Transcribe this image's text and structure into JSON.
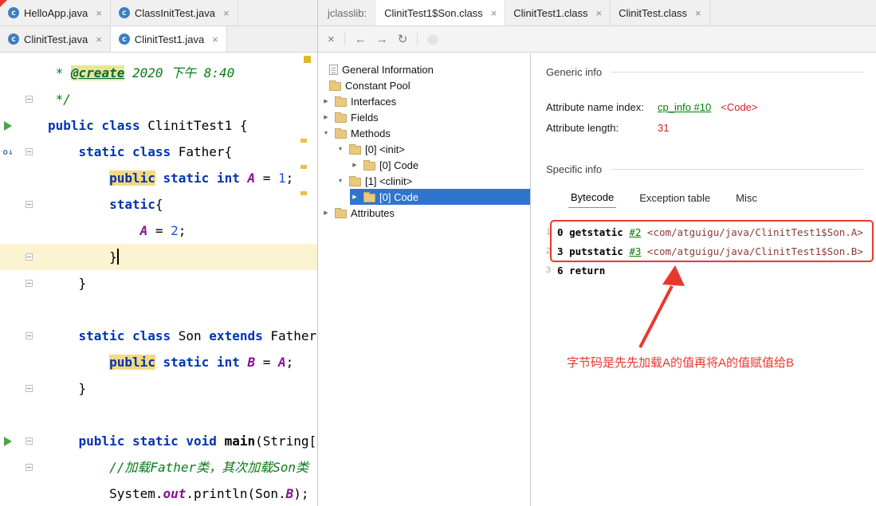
{
  "colors": {
    "annotation_red": "#E8382E",
    "tree_selection_blue": "#2E75CF",
    "link_green": "#008000",
    "keyword_blue": "#0033B3"
  },
  "icons": {
    "close": "×",
    "back": "←",
    "forward": "→",
    "refresh": "↻",
    "web": "◎",
    "java_class": "c",
    "expanded": "▼",
    "collapsed": "▶",
    "subclass": "o↓"
  },
  "editor_tabs": {
    "row1": [
      {
        "label": "HelloApp.java",
        "selected": false
      },
      {
        "label": "ClassInitTest.java",
        "selected": false
      }
    ],
    "row2": [
      {
        "label": "ClinitTest.java",
        "selected": false
      },
      {
        "label": "ClinitTest1.java",
        "selected": true
      }
    ]
  },
  "jclasslib": {
    "panel_label": "jclasslib:",
    "tabs": [
      {
        "label": "ClinitTest1$Son.class",
        "selected": true
      },
      {
        "label": "ClinitTest1.class",
        "selected": false
      },
      {
        "label": "ClinitTest.class",
        "selected": false
      }
    ],
    "toolbar": [
      {
        "name": "close",
        "glyph": "×"
      },
      {
        "sep": true
      },
      {
        "name": "back",
        "glyph": "←"
      },
      {
        "name": "forward",
        "glyph": "→"
      },
      {
        "name": "refresh",
        "glyph": "↻"
      },
      {
        "sep": true
      },
      {
        "name": "web",
        "glyph": "◎",
        "disabled": true
      }
    ]
  },
  "editor": {
    "lines": [
      {
        "tokens": [
          {
            "t": " * ",
            "c": "cmt"
          },
          {
            "t": "@create",
            "c": "tag"
          },
          {
            "t": " 2020 下午 8:40",
            "c": "cmt"
          }
        ]
      },
      {
        "fold": true,
        "tokens": [
          {
            "t": " */",
            "c": "cmt"
          }
        ]
      },
      {
        "run": true,
        "tokens": [
          {
            "t": "public class ",
            "c": "kw"
          },
          {
            "t": "ClinitTest1 {",
            "c": "pl"
          }
        ]
      },
      {
        "override": true,
        "fold": true,
        "tokens": [
          {
            "t": "    ",
            "c": "pl"
          },
          {
            "t": "static class ",
            "c": "kw"
          },
          {
            "t": "Father{",
            "c": "pl"
          }
        ]
      },
      {
        "tokens": [
          {
            "t": "        ",
            "c": "pl"
          },
          {
            "t": "public",
            "c": "kwhl"
          },
          {
            "t": " ",
            "c": "pl"
          },
          {
            "t": "static int ",
            "c": "kw"
          },
          {
            "t": "A",
            "c": "fld"
          },
          {
            "t": " = ",
            "c": "pl"
          },
          {
            "t": "1",
            "c": "num"
          },
          {
            "t": ";",
            "c": "pl"
          }
        ]
      },
      {
        "fold": true,
        "tokens": [
          {
            "t": "        ",
            "c": "pl"
          },
          {
            "t": "static",
            "c": "kw"
          },
          {
            "t": "{",
            "c": "pl"
          }
        ]
      },
      {
        "tokens": [
          {
            "t": "            ",
            "c": "pl"
          },
          {
            "t": "A",
            "c": "fld"
          },
          {
            "t": " = ",
            "c": "pl"
          },
          {
            "t": "2",
            "c": "num"
          },
          {
            "t": ";",
            "c": "pl"
          }
        ]
      },
      {
        "current": true,
        "caret": true,
        "fold": true,
        "tokens": [
          {
            "t": "        }",
            "c": "pl"
          }
        ]
      },
      {
        "fold": true,
        "tokens": [
          {
            "t": "    }",
            "c": "pl"
          }
        ]
      },
      {
        "tokens": []
      },
      {
        "fold": true,
        "tokens": [
          {
            "t": "    ",
            "c": "pl"
          },
          {
            "t": "static class ",
            "c": "kw"
          },
          {
            "t": "Son ",
            "c": "pl"
          },
          {
            "t": "extends ",
            "c": "kw"
          },
          {
            "t": "Father{",
            "c": "pl"
          }
        ]
      },
      {
        "tokens": [
          {
            "t": "        ",
            "c": "pl"
          },
          {
            "t": "public",
            "c": "kwhl"
          },
          {
            "t": " ",
            "c": "pl"
          },
          {
            "t": "static int ",
            "c": "kw"
          },
          {
            "t": "B",
            "c": "fld"
          },
          {
            "t": " = ",
            "c": "pl"
          },
          {
            "t": "A",
            "c": "fld"
          },
          {
            "t": ";",
            "c": "pl"
          }
        ]
      },
      {
        "fold": true,
        "tokens": [
          {
            "t": "    }",
            "c": "pl"
          }
        ]
      },
      {
        "tokens": []
      },
      {
        "run": true,
        "fold": true,
        "tokens": [
          {
            "t": "    ",
            "c": "pl"
          },
          {
            "t": "public static void ",
            "c": "kw"
          },
          {
            "t": "main",
            "c": "mth"
          },
          {
            "t": "(String[] args) {",
            "c": "pl"
          }
        ]
      },
      {
        "fold": true,
        "tokens": [
          {
            "t": "        ",
            "c": "pl"
          },
          {
            "t": "//加载Father类，其次加载Son类",
            "c": "cmt"
          }
        ]
      },
      {
        "tokens": [
          {
            "t": "        ",
            "c": "pl"
          },
          {
            "t": "System.",
            "c": "pl"
          },
          {
            "t": "out",
            "c": "fld"
          },
          {
            "t": ".println(Son.",
            "c": "pl"
          },
          {
            "t": "B",
            "c": "fld"
          },
          {
            "t": ");",
            "c": "pl"
          }
        ]
      }
    ]
  },
  "tree": {
    "items": [
      {
        "label": "General Information",
        "icon": "document",
        "depth": 0,
        "arrow": "none",
        "selected": false
      },
      {
        "label": "Constant Pool",
        "icon": "folder",
        "depth": 0,
        "arrow": "none",
        "selected": false
      },
      {
        "label": "Interfaces",
        "icon": "folder",
        "depth": 0,
        "arrow": "collapsed",
        "selected": false
      },
      {
        "label": "Fields",
        "icon": "folder",
        "depth": 0,
        "arrow": "collapsed",
        "selected": false
      },
      {
        "label": "Methods",
        "icon": "folder",
        "depth": 0,
        "arrow": "expanded",
        "selected": false
      },
      {
        "label": "[0] <init>",
        "icon": "folder",
        "depth": 1,
        "arrow": "expanded",
        "selected": false
      },
      {
        "label": "[0] Code",
        "icon": "folder",
        "depth": 2,
        "arrow": "collapsed",
        "selected": false
      },
      {
        "label": "[1] <clinit>",
        "icon": "folder",
        "depth": 1,
        "arrow": "expanded",
        "selected": false
      },
      {
        "label": "[0] Code",
        "icon": "folder",
        "depth": 2,
        "arrow": "collapsed",
        "selected": true
      },
      {
        "label": "Attributes",
        "icon": "folder",
        "depth": 0,
        "arrow": "collapsed",
        "selected": false
      }
    ]
  },
  "details": {
    "generic_info": {
      "title": "Generic info",
      "rows": [
        {
          "label": "Attribute name index:",
          "link": "cp_info #10",
          "extra": "<Code>"
        },
        {
          "label": "Attribute length:",
          "value": "31"
        }
      ]
    },
    "specific_info": {
      "title": "Specific info",
      "tabs": [
        {
          "label": "Bytecode",
          "selected": true
        },
        {
          "label": "Exception table",
          "selected": false
        },
        {
          "label": "Misc",
          "selected": false
        }
      ],
      "bytecode": [
        {
          "line": "1",
          "offset": "0",
          "mnemonic": "getstatic",
          "ref": "#2",
          "operand": "<com/atguigu/java/ClinitTest1$Son.A>"
        },
        {
          "line": "2",
          "offset": "3",
          "mnemonic": "putstatic",
          "ref": "#3",
          "operand": "<com/atguigu/java/ClinitTest1$Son.B>"
        },
        {
          "line": "3",
          "offset": "6",
          "mnemonic": "return"
        }
      ]
    },
    "annotation": {
      "text": "字节码是先先加载A的值再将A的值赋值给B",
      "color": "#E8382E"
    }
  }
}
